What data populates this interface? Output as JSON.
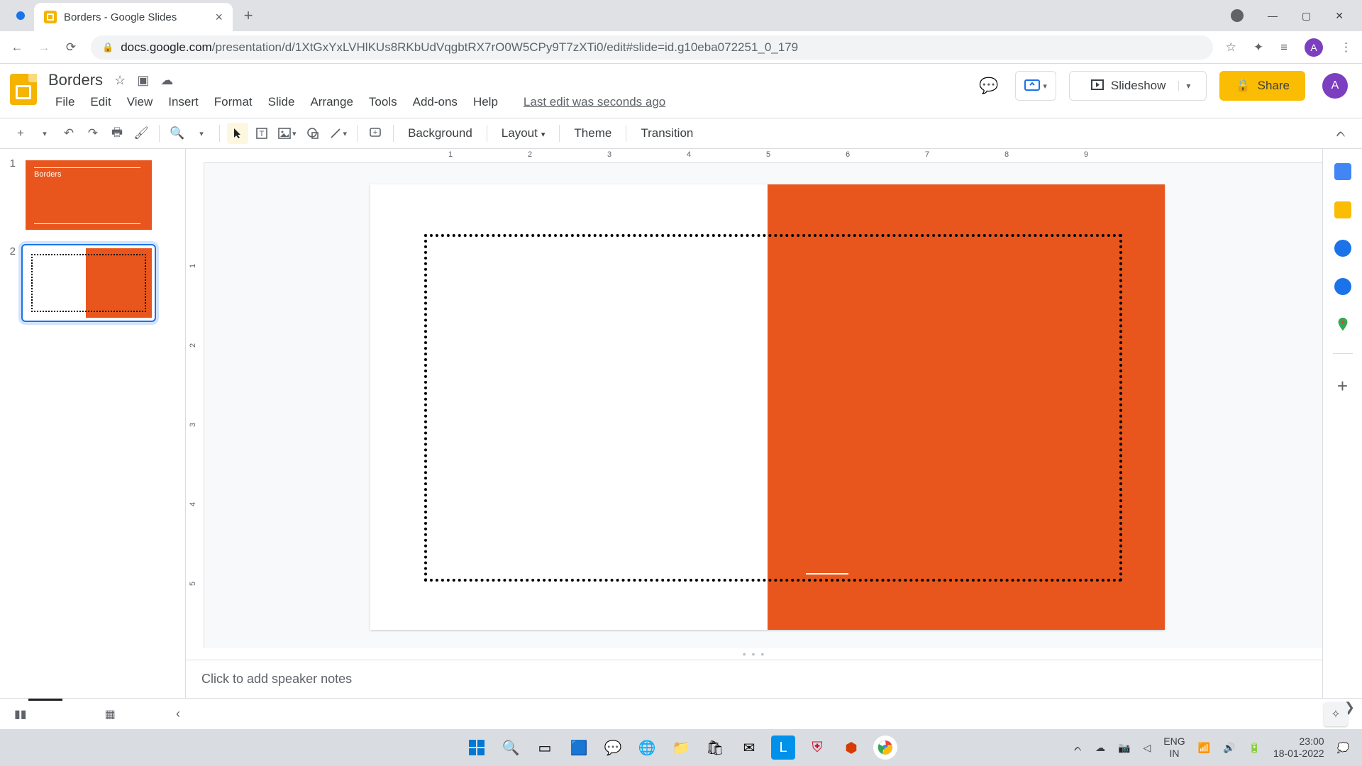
{
  "browser": {
    "tab_title": "Borders - Google Slides",
    "url_host": "docs.google.com",
    "url_path": "/presentation/d/1XtGxYxLVHlKUs8RKbUdVqgbtRX7rO0W5CPy9T7zXTi0/edit#slide=id.g10eba072251_0_179",
    "avatar_letter": "A"
  },
  "doc": {
    "title": "Borders",
    "menus": [
      "File",
      "Edit",
      "View",
      "Insert",
      "Format",
      "Slide",
      "Arrange",
      "Tools",
      "Add-ons",
      "Help"
    ],
    "edit_info": "Last edit was seconds ago",
    "slideshow": "Slideshow",
    "share": "Share"
  },
  "toolbar": {
    "background": "Background",
    "layout": "Layout",
    "theme": "Theme",
    "transition": "Transition"
  },
  "thumbs": {
    "slide1_title": "Borders",
    "n1": "1",
    "n2": "2"
  },
  "ruler_h": [
    "1",
    "2",
    "3",
    "4",
    "5",
    "6",
    "7",
    "8",
    "9"
  ],
  "ruler_v": [
    "1",
    "2",
    "3",
    "4",
    "5"
  ],
  "notes_placeholder": "Click to add speaker notes",
  "tray": {
    "lang1": "ENG",
    "lang2": "IN",
    "time": "23:00",
    "date": "18-01-2022"
  }
}
